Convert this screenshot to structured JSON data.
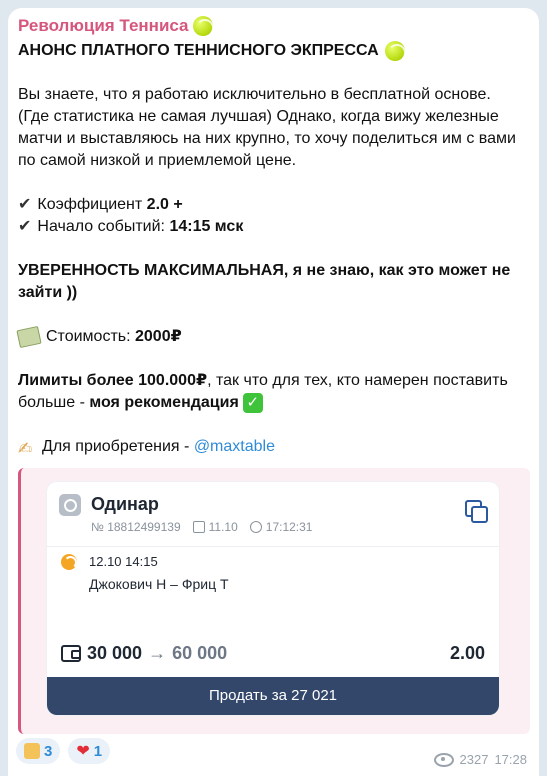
{
  "channel": {
    "name": "Революция Тенниса"
  },
  "post": {
    "title": "АНОНС ПЛАТНОГО ТЕННИСНОГО ЭКПРЕССА",
    "intro": "Вы знаете, что я работаю исключительно в бесплатной основе. (Где статистика не самая лучшая) Однако, когда вижу железные матчи и выставляюсь на них крупно, то хочу поделиться им с вами по самой низкой и приемлемой цене.",
    "coef_label": "Коэффициент ",
    "coef_value": "2.0 +",
    "start_label": "Начало событий: ",
    "start_value": "14:15 мск",
    "confidence": "УВЕРЕННОСТЬ МАКСИМАЛЬНАЯ, я не знаю, как это может не зайти ))",
    "price_label": "Стоимость: ",
    "price_value": "2000₽",
    "limits_bold": "Лимиты более 100.000₽",
    "limits_rest": ", так что для тех, кто намерен поставить больше - ",
    "recommendation": "моя рекомендация",
    "buy_label": "Для приобретения - ",
    "buy_link": "@maxtable"
  },
  "bet_card": {
    "type": "Одинар",
    "number": "№ 18812499139",
    "date": "11.10",
    "time": "17:12:31",
    "event_datetime": "12.10  14:15",
    "match": "Джокович Н – Фриц Т",
    "stake": "30 000",
    "payout": "60 000",
    "odds": "2.00",
    "sell_button": "Продать за 27 021"
  },
  "reactions": [
    {
      "icon": "thumbs-up",
      "count": "3"
    },
    {
      "icon": "heart",
      "count": "1"
    }
  ],
  "footer": {
    "views": "2327",
    "time": "17:28"
  }
}
